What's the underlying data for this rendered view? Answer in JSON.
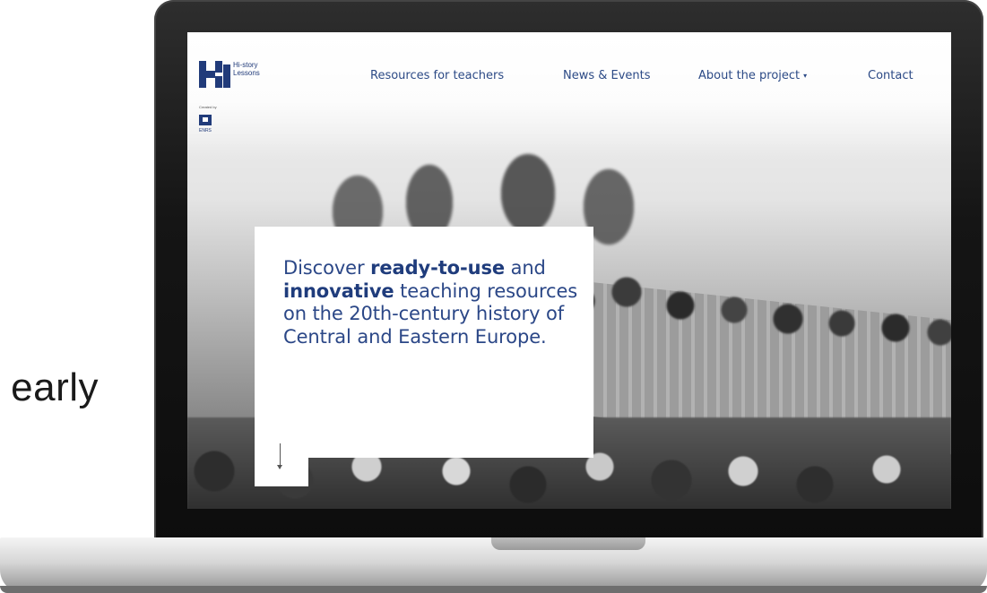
{
  "background_text": "early",
  "site": {
    "logo_text_line1": "Hi-story",
    "logo_text_line2": "Lessons",
    "created_by": "Created by",
    "partner_label": "ENRS"
  },
  "nav": {
    "items": [
      {
        "label": "Resources for teachers"
      },
      {
        "label": "News & Events"
      },
      {
        "label": "About the project",
        "has_dropdown": true,
        "caret": "▾"
      },
      {
        "label": "Contact"
      }
    ]
  },
  "hero": {
    "segments": [
      {
        "text": "Discover ",
        "bold": false
      },
      {
        "text": "ready-to-use",
        "bold": true
      },
      {
        "text": " and ",
        "bold": false
      },
      {
        "text": "innovative",
        "bold": true
      },
      {
        "text": " teaching resources on the 20th-century history of Central and Eastern Europe.",
        "bold": false
      }
    ],
    "scroll_icon": "arrow-down-icon"
  },
  "colors": {
    "brand_blue": "#2b4787",
    "accent": "#e3b341"
  }
}
